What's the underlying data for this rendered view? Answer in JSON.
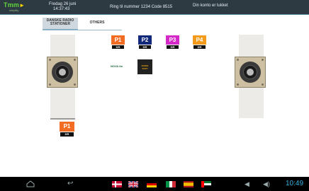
{
  "app": {
    "logo_main": "Tmm",
    "logo_sub": "simplify",
    "clock_day": "Fredag 26 juni",
    "clock_time": "14:37:43",
    "phone_info": "Ring til nummer 1234 Code 8515",
    "account_status": "Din konto er lukket"
  },
  "tabs": [
    {
      "label_line1": "DANSKE RADIO",
      "label_line2": "STATIONER",
      "active": true
    },
    {
      "label": "OTHERS",
      "active": false
    }
  ],
  "stations": [
    {
      "top": "P1",
      "bottom": "DR",
      "color": "#f26c23"
    },
    {
      "top": "P2",
      "bottom": "DR",
      "color": "#12287a"
    },
    {
      "top": "P3",
      "bottom": "DR",
      "color": "#d528c8"
    },
    {
      "top": "P4",
      "bottom": "DR",
      "color": "#f39a1b"
    },
    {
      "text": "NOVA fm"
    },
    {
      "text_line1": "RADIO",
      "text_line2": "SOFT"
    }
  ],
  "now_playing": {
    "label": "DR P1",
    "logo_top": "P1",
    "logo_bottom": "DR",
    "color": "#f26c23"
  },
  "navbar": {
    "time": "10:49",
    "icons": [
      "home-icon",
      "back-icon"
    ],
    "flags": [
      "denmark",
      "uk",
      "germany",
      "italy",
      "spain",
      "arabic"
    ],
    "tray_icons": [
      "volume-down-icon",
      "volume-up-icon"
    ]
  }
}
